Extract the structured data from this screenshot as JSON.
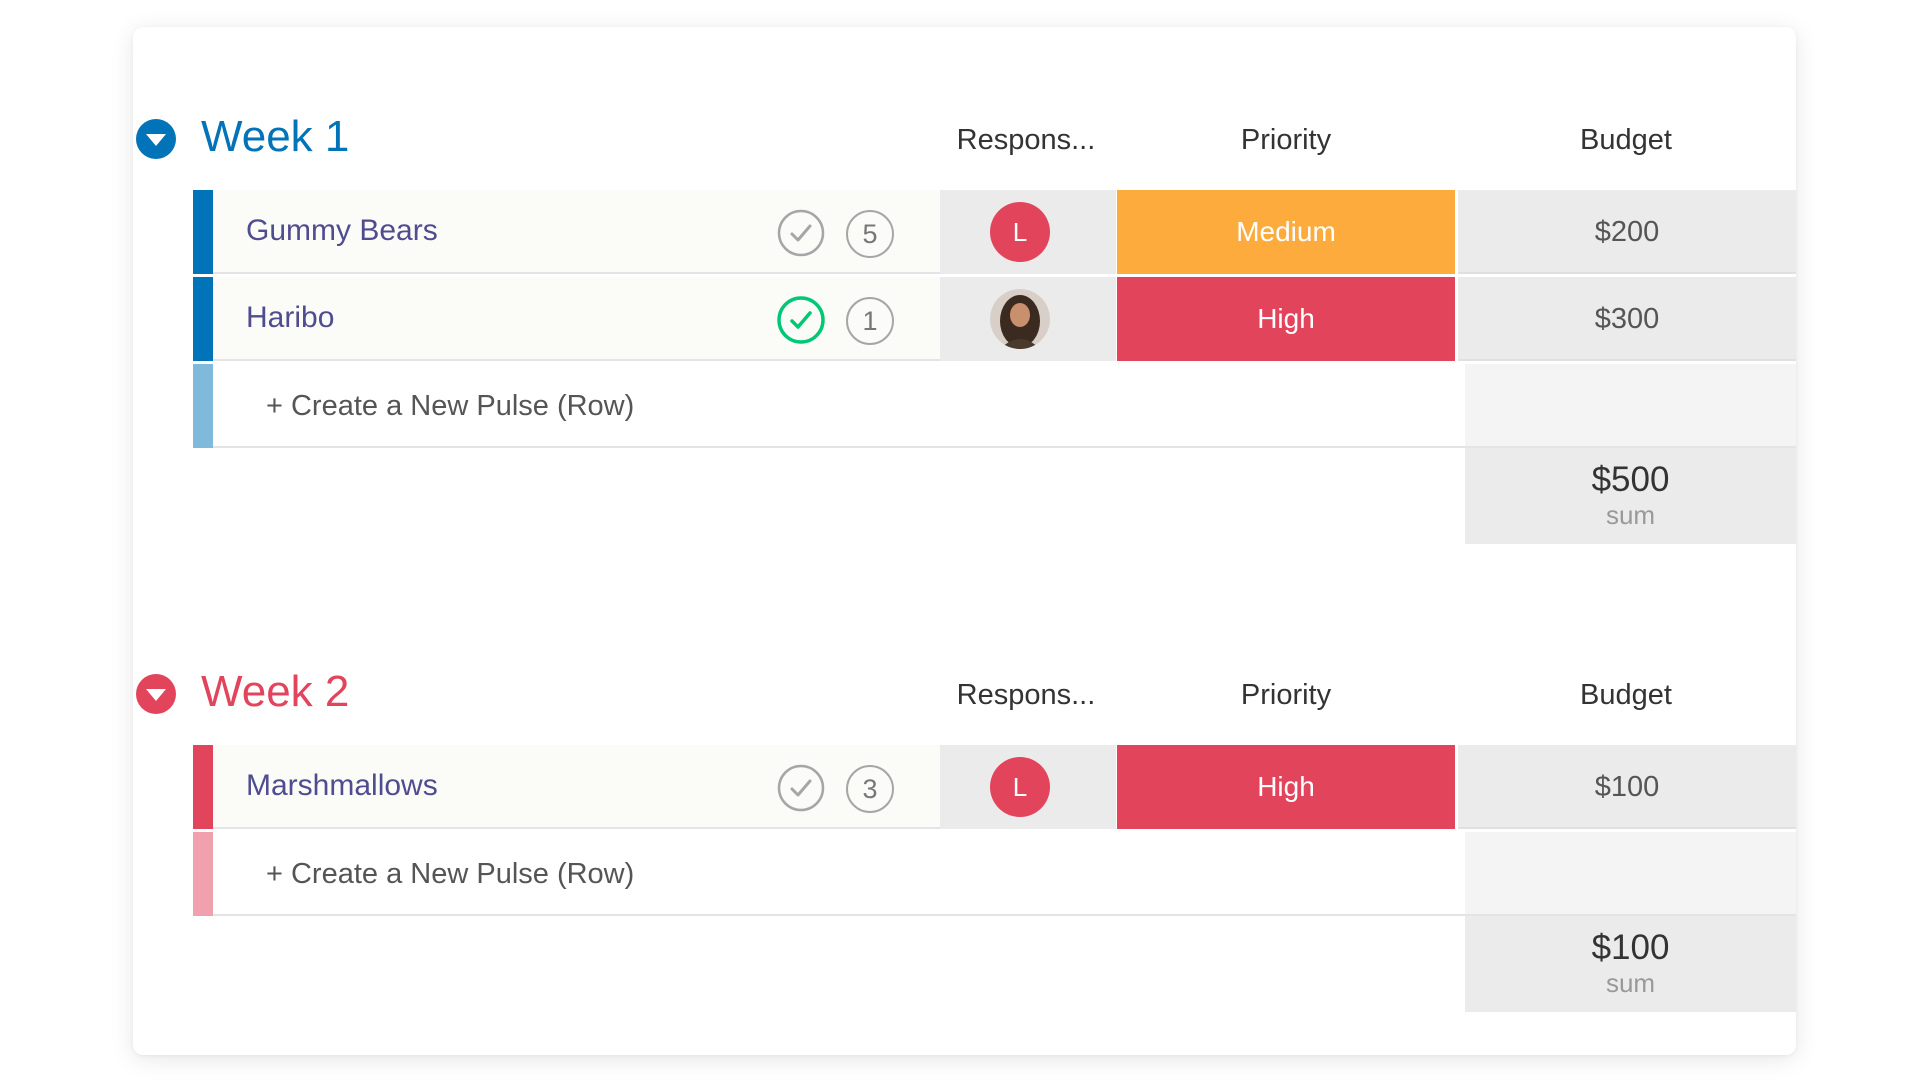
{
  "colors": {
    "week1": "#0073b9",
    "week2": "#e2445c",
    "medium": "#fdab3d",
    "high": "#e2445c",
    "done_check": "#00c875"
  },
  "groups": [
    {
      "title": "Week 1",
      "columns": {
        "responsible": "Respons...",
        "priority": "Priority",
        "budget": "Budget"
      },
      "rows": [
        {
          "name": "Gummy Bears",
          "updates": "5",
          "responsible": "L",
          "priority": "Medium",
          "budget": "$200"
        },
        {
          "name": "Haribo",
          "updates": "1",
          "responsible": "photo",
          "priority": "High",
          "budget": "$300"
        }
      ],
      "new_row_label": "+ Create a New Pulse (Row)",
      "sum": {
        "value": "$500",
        "label": "sum"
      }
    },
    {
      "title": "Week 2",
      "columns": {
        "responsible": "Respons...",
        "priority": "Priority",
        "budget": "Budget"
      },
      "rows": [
        {
          "name": "Marshmallows",
          "updates": "3",
          "responsible": "L",
          "priority": "High",
          "budget": "$100"
        }
      ],
      "new_row_label": "+ Create a New Pulse (Row)",
      "sum": {
        "value": "$100",
        "label": "sum"
      }
    }
  ]
}
